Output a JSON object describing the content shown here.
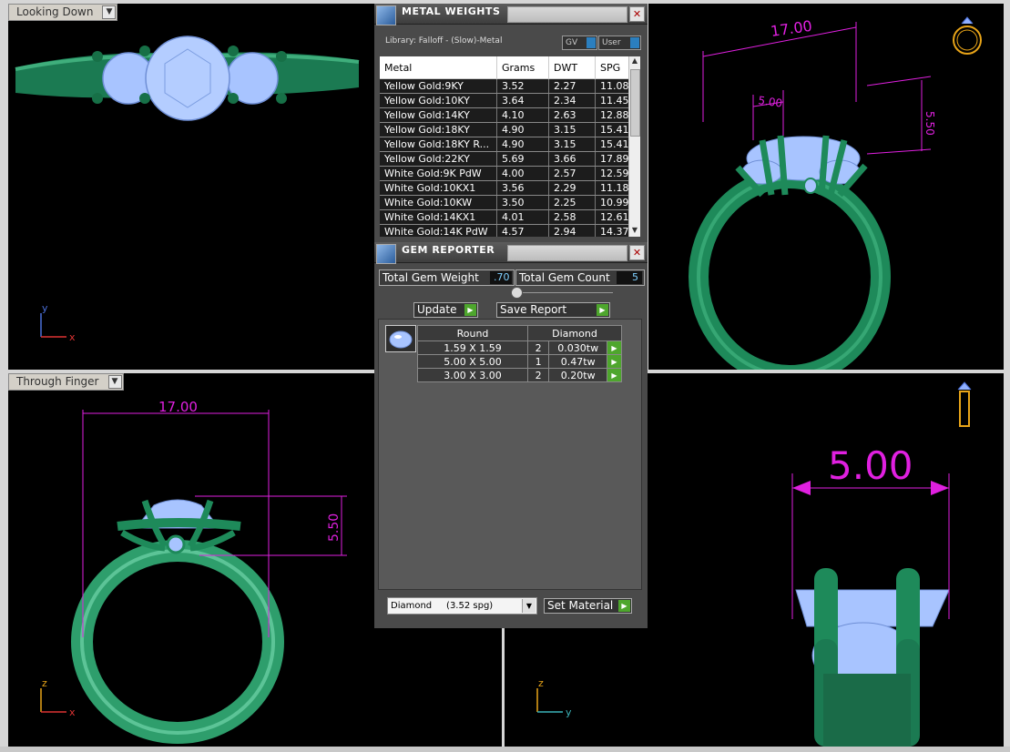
{
  "viewports": {
    "top_left": {
      "label": "Looking Down",
      "axis_v": "y",
      "axis_h": "x"
    },
    "top_right": {
      "dim_width": "17.00",
      "dim_small": "5.00",
      "dim_height": "5.50"
    },
    "bottom_left": {
      "label": "Through Finger",
      "dim_width": "17.00",
      "dim_height": "5.50",
      "axis_v": "z",
      "axis_h": "x"
    },
    "bottom_right": {
      "dim_width": "5.00",
      "axis_v": "z",
      "axis_h": "y"
    }
  },
  "metal_weights": {
    "title": "METAL WEIGHTS",
    "library": "Library: Falloff - (Slow)-Metal",
    "toggle_gv": "GV",
    "toggle_user": "User",
    "columns": [
      "Metal",
      "Grams",
      "DWT",
      "SPG"
    ],
    "rows": [
      [
        "Yellow Gold:9KY",
        "3.52",
        "2.27",
        "11.08"
      ],
      [
        "Yellow Gold:10KY",
        "3.64",
        "2.34",
        "11.45"
      ],
      [
        "Yellow Gold:14KY",
        "4.10",
        "2.63",
        "12.88"
      ],
      [
        "Yellow Gold:18KY",
        "4.90",
        "3.15",
        "15.41"
      ],
      [
        "Yellow Gold:18KY R...",
        "4.90",
        "3.15",
        "15.41"
      ],
      [
        "Yellow Gold:22KY",
        "5.69",
        "3.66",
        "17.89"
      ],
      [
        "White Gold:9K PdW",
        "4.00",
        "2.57",
        "12.59"
      ],
      [
        "White Gold:10KX1",
        "3.56",
        "2.29",
        "11.18"
      ],
      [
        "White Gold:10KW",
        "3.50",
        "2.25",
        "10.99"
      ],
      [
        "White Gold:14KX1",
        "4.01",
        "2.58",
        "12.61"
      ],
      [
        "White Gold:14K PdW",
        "4.57",
        "2.94",
        "14.37"
      ]
    ]
  },
  "gem_reporter": {
    "title": "GEM REPORTER",
    "total_weight_label": "Total Gem Weight",
    "total_weight_value": ".70",
    "total_count_label": "Total Gem Count",
    "total_count_value": "5",
    "update_label": "Update",
    "save_report_label": "Save Report",
    "shape_header": "Round",
    "material_header": "Diamond",
    "gems": [
      {
        "size": "1.59 X 1.59",
        "count": "2",
        "weight": "0.030tw"
      },
      {
        "size": "5.00 X 5.00",
        "count": "1",
        "weight": "0.47tw"
      },
      {
        "size": "3.00 X 3.00",
        "count": "2",
        "weight": "0.20tw"
      }
    ],
    "material_select": "Diamond     (3.52 spg)",
    "set_material_label": "Set Material"
  },
  "colors": {
    "metal": "#1e8a5a",
    "gem": "#a8c4ff",
    "dimension": "#e020e0"
  }
}
